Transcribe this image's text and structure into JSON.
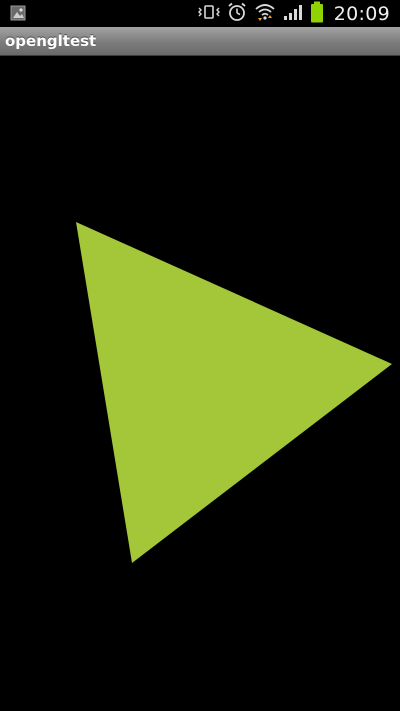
{
  "status_bar": {
    "time": "20:09",
    "icons": [
      "gallery-notification-icon",
      "vibrate-mode-icon",
      "alarm-clock-icon",
      "wifi-icon",
      "signal-strength-icon",
      "battery-icon"
    ]
  },
  "app": {
    "title": "opengltest"
  },
  "surface": {
    "background_color": "#000000",
    "triangle_color": "#a4c639",
    "shape": "triangle"
  }
}
